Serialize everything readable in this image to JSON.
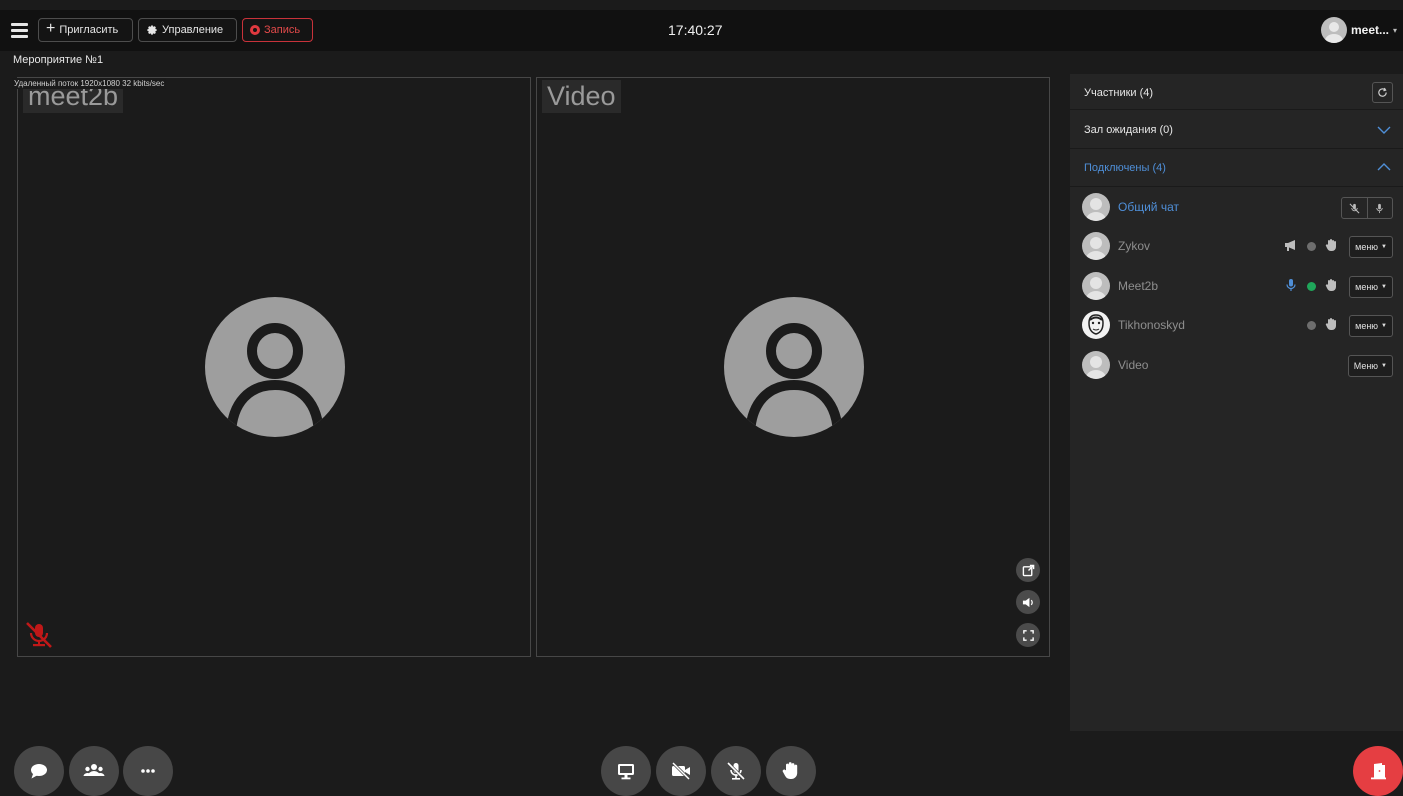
{
  "topbar": {
    "invite_label": "Пригласить",
    "manage_label": "Управление",
    "record_label": "Запись",
    "clock": "17:40:27",
    "user_name": "meet...",
    "user_caret": "▾"
  },
  "event": {
    "title": "Мероприятие №1"
  },
  "stream_info": "Удаленный поток 1920x1080 32 kbits/sec",
  "tiles": [
    {
      "label": "meet2b"
    },
    {
      "label": "Video"
    }
  ],
  "panel": {
    "participants_title": "Участники",
    "participants_count": "(4)",
    "waiting_title": "Зал ожидания (0)",
    "connected_title": "Подключены (4)",
    "participants": [
      {
        "name": "Общий чат"
      },
      {
        "name": "Zykov",
        "menu": "меню",
        "status": "grey"
      },
      {
        "name": "Meet2b",
        "menu": "меню",
        "status": "green"
      },
      {
        "name": "Tikhonoskyd",
        "menu": "меню",
        "status": "grey"
      },
      {
        "name": "Video",
        "menu": "Меню"
      }
    ]
  },
  "colors": {
    "accent": "#4f8fd8",
    "record_red": "#e0393f",
    "exit_red": "#e53e42",
    "status_green": "#1fa65a",
    "mic_off_red": "#d11a1a"
  },
  "icons": {
    "bottom_left": [
      "chat-icon",
      "participants-icon",
      "more-icon"
    ],
    "bottom_center": [
      "screen-share-icon",
      "camera-off-icon",
      "mic-off-icon",
      "raise-hand-icon"
    ],
    "bottom_right": [
      "exit-door-icon"
    ]
  }
}
